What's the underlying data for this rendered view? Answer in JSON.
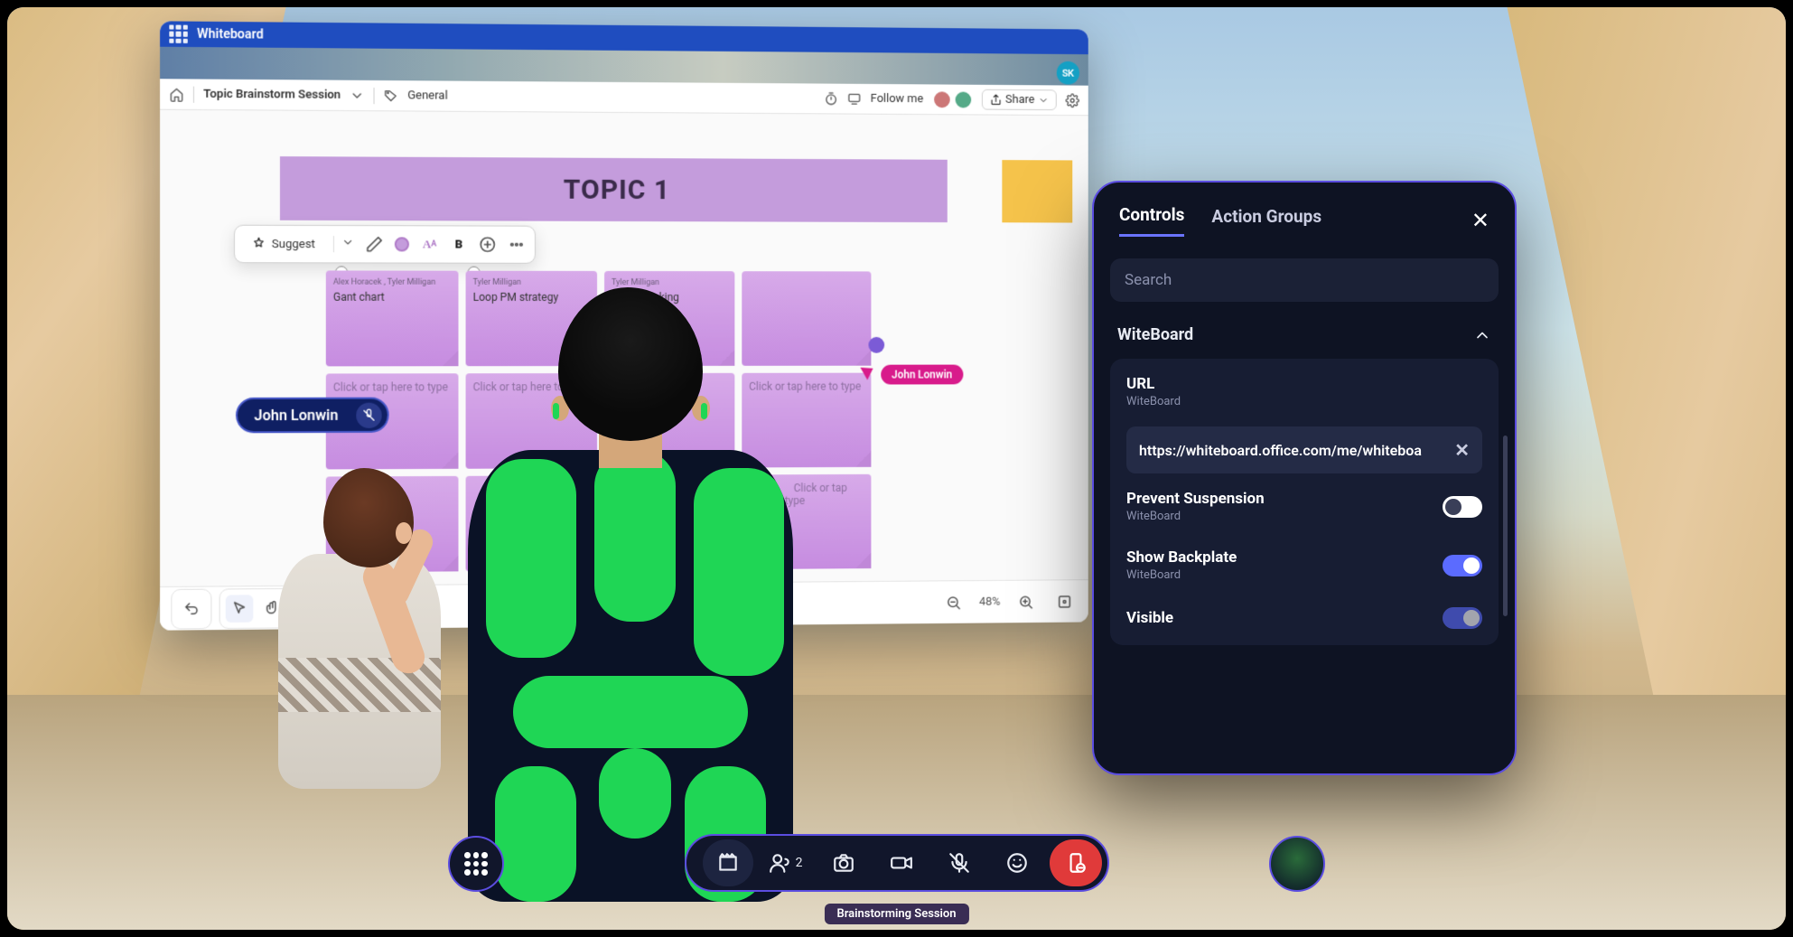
{
  "whiteboard": {
    "app_title": "Whiteboard",
    "session_title": "Topic Brainstorm Session",
    "tag": "General",
    "follow_me": "Follow me",
    "share": "Share",
    "user_initials": "SK",
    "topic_banner": "TOPIC 1",
    "suggest": "Suggest",
    "notes": {
      "n1_author": "Alex Horacek , Tyler Milligan",
      "n1": "Gant chart",
      "n2_author": "Tyler Milligan",
      "n2": "Loop PM strategy",
      "n3_author": "Tyler Milligan",
      "n3": "Time blocking",
      "placeholder": "Click or tap here to type"
    },
    "cursor_user": "John Lonwin",
    "pill_user": "John Lonwin",
    "zoom": "48%"
  },
  "panel": {
    "tab_controls": "Controls",
    "tab_groups": "Action Groups",
    "search_placeholder": "Search",
    "section_title": "WiteBoard",
    "url_label": "URL",
    "url_sub": "WiteBoard",
    "url_value": "https://whiteboard.office.com/me/whiteboa",
    "prevent_label": "Prevent Suspension",
    "prevent_sub": "WiteBoard",
    "backplate_label": "Show Backplate",
    "backplate_sub": "WiteBoard",
    "visible_label": "Visible"
  },
  "bottom": {
    "participants": "2",
    "session_label": "Brainstorming Session"
  }
}
